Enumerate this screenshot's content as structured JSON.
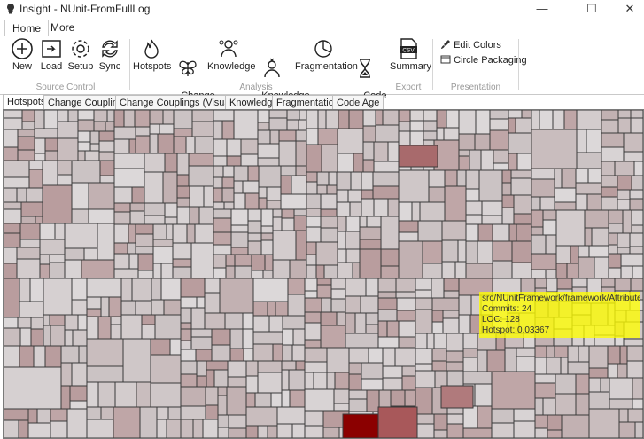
{
  "window": {
    "title": "Insight - NUnit-FromFullLog"
  },
  "ribbon_tabs": [
    "Home",
    "More"
  ],
  "ribbon": {
    "source_control": {
      "group_label": "Source Control",
      "buttons": [
        "New",
        "Load",
        "Setup",
        "Sync"
      ]
    },
    "analysis": {
      "group_label": "Analysis",
      "buttons": [
        "Hotspots",
        "Change\nCoupling",
        "Knowledge",
        "Knowledge\nLoss",
        "Fragmentation",
        "Code\nAge"
      ]
    },
    "export": {
      "group_label": "Export",
      "buttons": [
        "Summary"
      ]
    },
    "presentation": {
      "group_label": "Presentation",
      "items": [
        "Edit Colors",
        "Circle Packaging"
      ]
    }
  },
  "view_tabs": [
    "Hotspots",
    "Change Couplings",
    "Change Couplings (Visualize)",
    "Knowledge",
    "Fragmentation",
    "Code Age"
  ],
  "tooltip": {
    "path": "src/NUnitFramework/framework/Attributes/Te",
    "commits": "Commits: 24",
    "loc": "LOC: 128",
    "hotspot": "Hotspot: 0.03367"
  },
  "colors": {
    "accent": "#8b0000",
    "tooltip_bg": "#ffff00",
    "treemap_base": "#d9d5d6"
  }
}
